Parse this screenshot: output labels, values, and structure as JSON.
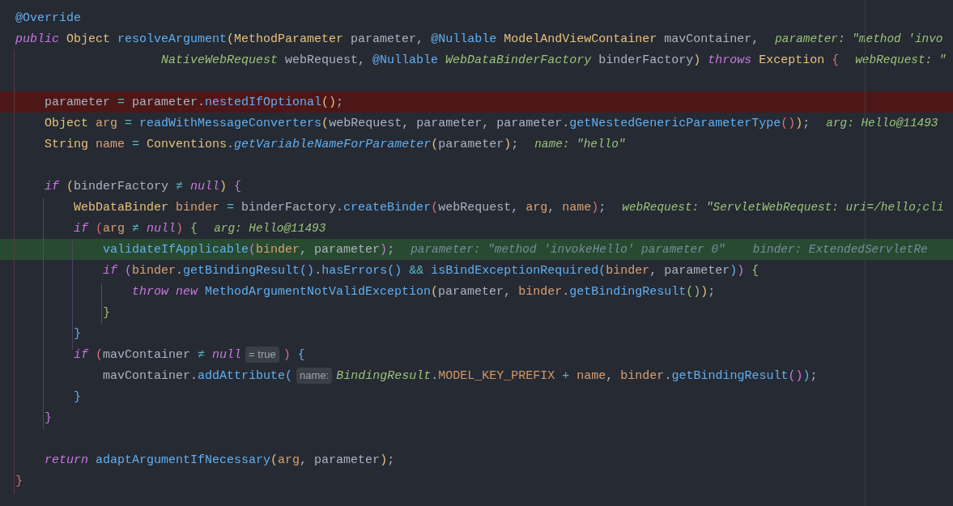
{
  "editor": {
    "lines": [
      {
        "tokens": [
          {
            "kind": "ann",
            "text": "@Override"
          }
        ]
      },
      {
        "tokens": [
          {
            "kind": "kw",
            "text": "public "
          },
          {
            "kind": "type",
            "text": "Object "
          },
          {
            "kind": "fn",
            "text": "resolveArgument"
          },
          {
            "kind": "p1",
            "text": "("
          },
          {
            "kind": "type",
            "text": "MethodParameter "
          },
          {
            "kind": "id",
            "text": "parameter, "
          },
          {
            "kind": "ann",
            "text": "@Nullable "
          },
          {
            "kind": "type",
            "text": "ModelAndViewContainer "
          },
          {
            "kind": "id",
            "text": "mavContainer,"
          },
          {
            "kind": "debug",
            "text": "parameter: \"method 'invo"
          }
        ]
      },
      {
        "tokens": [
          {
            "kind": "iface",
            "text": "                    NativeWebRequest "
          },
          {
            "kind": "id",
            "text": "webRequest, "
          },
          {
            "kind": "ann",
            "text": "@Nullable "
          },
          {
            "kind": "iface",
            "text": "WebDataBinderFactory "
          },
          {
            "kind": "id",
            "text": "binderFactory"
          },
          {
            "kind": "p1",
            "text": ") "
          },
          {
            "kind": "kw",
            "text": "throws "
          },
          {
            "kind": "type",
            "text": "Exception "
          },
          {
            "kind": "p2",
            "text": "{"
          },
          {
            "kind": "debug",
            "text": "webRequest: \""
          }
        ]
      },
      {
        "gap_before": true,
        "breakpoint": true,
        "tokens": [
          {
            "kind": "id",
            "text": "    parameter "
          },
          {
            "kind": "op",
            "text": "= "
          },
          {
            "kind": "id",
            "text": "parameter."
          },
          {
            "kind": "fn",
            "text": "nestedIfOptional"
          },
          {
            "kind": "p1",
            "text": "()"
          },
          {
            "kind": "id",
            "text": ";"
          }
        ]
      },
      {
        "tokens": [
          {
            "kind": "type",
            "text": "    Object "
          },
          {
            "kind": "var",
            "text": "arg "
          },
          {
            "kind": "op",
            "text": "= "
          },
          {
            "kind": "fn",
            "text": "readWithMessageConverters"
          },
          {
            "kind": "p1",
            "text": "("
          },
          {
            "kind": "id",
            "text": "webRequest, parameter, parameter."
          },
          {
            "kind": "fn",
            "text": "getNestedGenericParameterType"
          },
          {
            "kind": "p2",
            "text": "()"
          },
          {
            "kind": "p1",
            "text": ")"
          },
          {
            "kind": "id",
            "text": ";"
          },
          {
            "kind": "debug",
            "text": "arg: Hello@11493"
          }
        ]
      },
      {
        "tokens": [
          {
            "kind": "type",
            "text": "    String "
          },
          {
            "kind": "var",
            "text": "name "
          },
          {
            "kind": "op",
            "text": "= "
          },
          {
            "kind": "type",
            "text": "Conventions"
          },
          {
            "kind": "id",
            "text": "."
          },
          {
            "kind": "sfn",
            "text": "getVariableNameForParameter"
          },
          {
            "kind": "p1",
            "text": "("
          },
          {
            "kind": "id",
            "text": "parameter"
          },
          {
            "kind": "p1",
            "text": ")"
          },
          {
            "kind": "id",
            "text": ";"
          },
          {
            "kind": "debug",
            "text": "name: \"hello\""
          }
        ]
      },
      {
        "gap_before": true,
        "tokens": [
          {
            "kind": "kw",
            "text": "    if "
          },
          {
            "kind": "p1",
            "text": "("
          },
          {
            "kind": "id",
            "text": "binderFactory "
          },
          {
            "kind": "op",
            "text": "≠ "
          },
          {
            "kind": "kw",
            "text": "null"
          },
          {
            "kind": "p1",
            "text": ") "
          },
          {
            "kind": "p3",
            "text": "{"
          }
        ]
      },
      {
        "tokens": [
          {
            "kind": "type",
            "text": "        WebDataBinder "
          },
          {
            "kind": "var",
            "text": "binder "
          },
          {
            "kind": "op",
            "text": "= "
          },
          {
            "kind": "id",
            "text": "binderFactory."
          },
          {
            "kind": "fn",
            "text": "createBinder"
          },
          {
            "kind": "p2",
            "text": "("
          },
          {
            "kind": "id",
            "text": "webRequest, "
          },
          {
            "kind": "var",
            "text": "arg"
          },
          {
            "kind": "id",
            "text": ", "
          },
          {
            "kind": "var",
            "text": "name"
          },
          {
            "kind": "p2",
            "text": ")"
          },
          {
            "kind": "id",
            "text": ";"
          },
          {
            "kind": "debug",
            "text": "webRequest: \"ServletWebRequest: uri=/hello;cli"
          }
        ]
      },
      {
        "tokens": [
          {
            "kind": "kw",
            "text": "        if "
          },
          {
            "kind": "p2",
            "text": "("
          },
          {
            "kind": "var",
            "text": "arg "
          },
          {
            "kind": "op",
            "text": "≠ "
          },
          {
            "kind": "kw",
            "text": "null"
          },
          {
            "kind": "p2",
            "text": ") "
          },
          {
            "kind": "p4",
            "text": "{"
          },
          {
            "kind": "debug",
            "text": "arg: Hello@11493"
          }
        ]
      },
      {
        "execution_point": true,
        "tokens": [
          {
            "kind": "fn",
            "text": "            validateIfApplicable"
          },
          {
            "kind": "p3",
            "text": "("
          },
          {
            "kind": "var",
            "text": "binder"
          },
          {
            "kind": "id",
            "text": ", parameter"
          },
          {
            "kind": "p3",
            "text": ")"
          },
          {
            "kind": "id",
            "text": ";"
          },
          {
            "kind": "dim",
            "text": "parameter: \"method 'invokeHello' parameter 0\""
          },
          {
            "kind": "dim",
            "text": "binder: ExtendedServletRe"
          }
        ]
      },
      {
        "tokens": [
          {
            "kind": "kw",
            "text": "            if "
          },
          {
            "kind": "p3",
            "text": "("
          },
          {
            "kind": "var",
            "text": "binder"
          },
          {
            "kind": "id",
            "text": "."
          },
          {
            "kind": "fn",
            "text": "getBindingResult"
          },
          {
            "kind": "p5",
            "text": "()"
          },
          {
            "kind": "id",
            "text": "."
          },
          {
            "kind": "fn",
            "text": "hasErrors"
          },
          {
            "kind": "p5",
            "text": "() "
          },
          {
            "kind": "op",
            "text": "&& "
          },
          {
            "kind": "fn",
            "text": "isBindExceptionRequired"
          },
          {
            "kind": "p5",
            "text": "("
          },
          {
            "kind": "var",
            "text": "binder"
          },
          {
            "kind": "id",
            "text": ", parameter"
          },
          {
            "kind": "p5",
            "text": ")"
          },
          {
            "kind": "p3",
            "text": ") "
          },
          {
            "kind": "p4",
            "text": "{"
          }
        ]
      },
      {
        "tokens": [
          {
            "kind": "kw",
            "text": "                throw new "
          },
          {
            "kind": "fn",
            "text": "MethodArgumentNotValidException"
          },
          {
            "kind": "p1",
            "text": "("
          },
          {
            "kind": "id",
            "text": "parameter, "
          },
          {
            "kind": "var",
            "text": "binder"
          },
          {
            "kind": "id",
            "text": "."
          },
          {
            "kind": "fn",
            "text": "getBindingResult"
          },
          {
            "kind": "p4",
            "text": "()"
          },
          {
            "kind": "p1",
            "text": ")"
          },
          {
            "kind": "id",
            "text": ";"
          }
        ]
      },
      {
        "tokens": [
          {
            "kind": "p4",
            "text": "            }"
          }
        ]
      },
      {
        "tokens": [
          {
            "kind": "p5",
            "text": "        }"
          }
        ]
      },
      {
        "tokens": [
          {
            "kind": "kw",
            "text": "        if "
          },
          {
            "kind": "p2",
            "text": "("
          },
          {
            "kind": "id",
            "text": "mavContainer "
          },
          {
            "kind": "op",
            "text": "≠ "
          },
          {
            "kind": "kw",
            "text": "null"
          },
          {
            "kind": "hint",
            "text": "= true"
          },
          {
            "kind": "p2",
            "text": ") "
          },
          {
            "kind": "p5",
            "text": "{"
          }
        ]
      },
      {
        "tokens": [
          {
            "kind": "id",
            "text": "            mavContainer."
          },
          {
            "kind": "fn",
            "text": "addAttribute"
          },
          {
            "kind": "p5",
            "text": "("
          },
          {
            "kind": "hint",
            "text": "name:"
          },
          {
            "kind": "iface",
            "text": "BindingResult"
          },
          {
            "kind": "id",
            "text": "."
          },
          {
            "kind": "const",
            "text": "MODEL_KEY_PREFIX "
          },
          {
            "kind": "op",
            "text": "+ "
          },
          {
            "kind": "var",
            "text": "name"
          },
          {
            "kind": "id",
            "text": ", "
          },
          {
            "kind": "var",
            "text": "binder"
          },
          {
            "kind": "id",
            "text": "."
          },
          {
            "kind": "fn",
            "text": "getBindingResult"
          },
          {
            "kind": "p3",
            "text": "()"
          },
          {
            "kind": "p5",
            "text": ")"
          },
          {
            "kind": "id",
            "text": ";"
          }
        ]
      },
      {
        "tokens": [
          {
            "kind": "p5",
            "text": "        }"
          }
        ]
      },
      {
        "tokens": [
          {
            "kind": "p3",
            "text": "    }"
          }
        ]
      },
      {
        "gap_before": true,
        "tokens": [
          {
            "kind": "kw",
            "text": "    return "
          },
          {
            "kind": "fn",
            "text": "adaptArgumentIfNecessary"
          },
          {
            "kind": "p1",
            "text": "("
          },
          {
            "kind": "var",
            "text": "arg"
          },
          {
            "kind": "id",
            "text": ", parameter"
          },
          {
            "kind": "p1",
            "text": ")"
          },
          {
            "kind": "id",
            "text": ";"
          }
        ]
      },
      {
        "tokens": [
          {
            "kind": "p2",
            "text": "}"
          }
        ]
      }
    ]
  }
}
